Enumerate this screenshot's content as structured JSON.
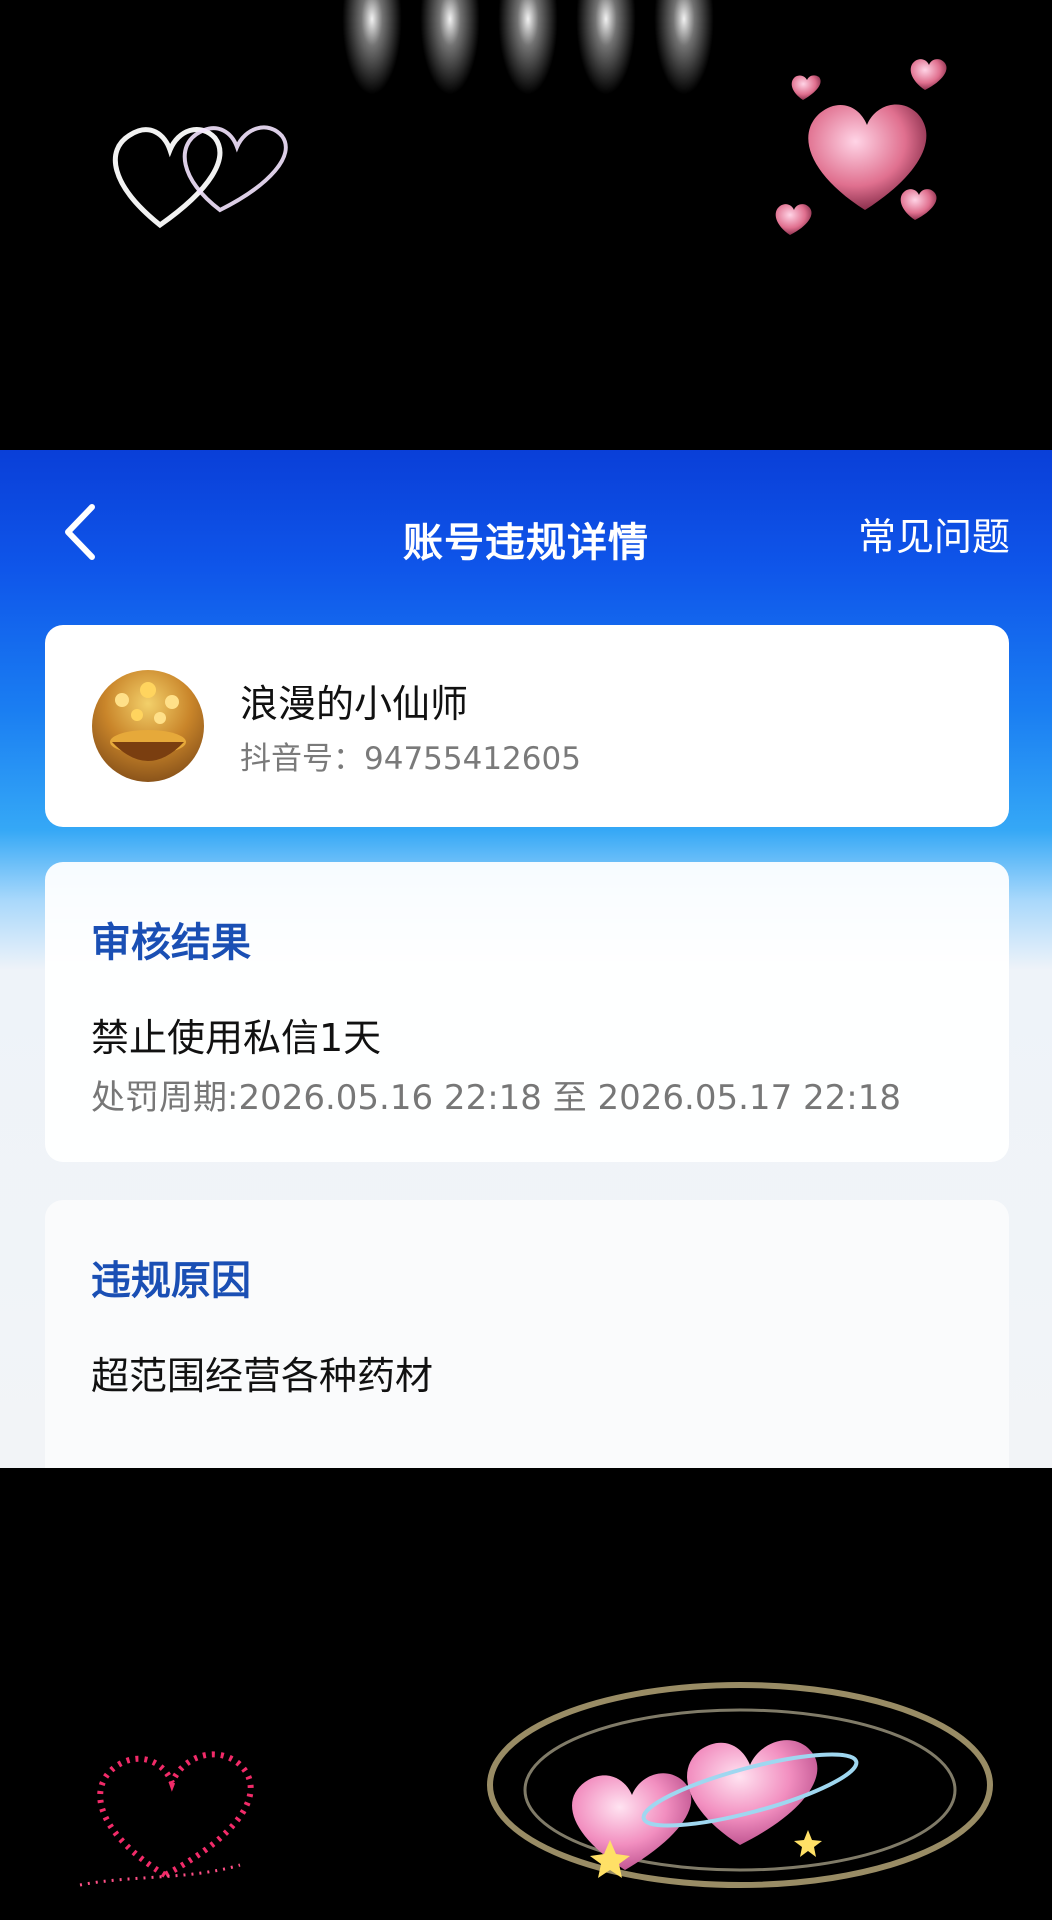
{
  "header": {
    "title": "账号违规详情",
    "faq_label": "常见问题"
  },
  "account": {
    "name": "浪漫的小仙师",
    "id_label": "抖音号：",
    "id_value": "94755412605"
  },
  "review": {
    "title": "审核结果",
    "result": "禁止使用私信1天",
    "period": "处罚周期:2026.05.16 22:18 至 2026.05.17 22:18"
  },
  "violation": {
    "title": "违规原因",
    "reason": "超范围经营各种药材"
  },
  "icons": {
    "back": "chevron-left-icon",
    "avatar": "gold-pot-avatar"
  },
  "colors": {
    "nav_blue": "#0f56ea",
    "section_title": "#1a4fb4",
    "background": "#000000"
  }
}
